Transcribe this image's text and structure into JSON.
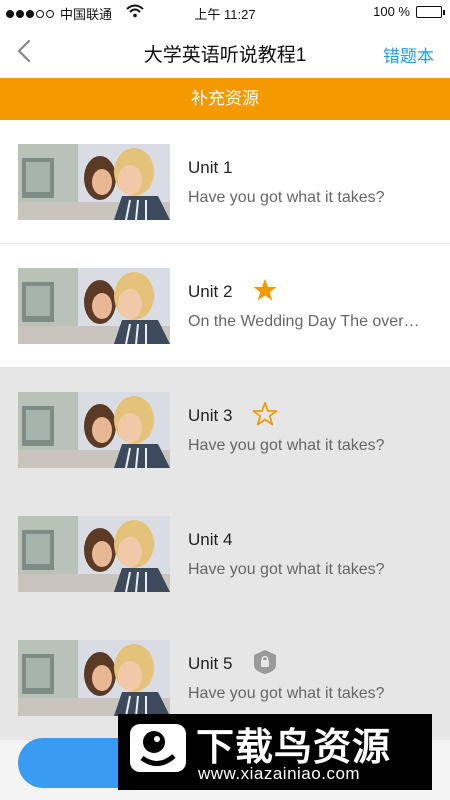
{
  "status_bar": {
    "carrier": "中国联通",
    "time": "上午 11:27",
    "battery": "100 %",
    "battery_level": 1.0
  },
  "nav": {
    "title": "大学英语听说教程1",
    "action_label": "错题本"
  },
  "section": {
    "label": "补充资源"
  },
  "units": [
    {
      "title": "Unit 1",
      "subtitle": "Have you got what it takes?",
      "badge": "none",
      "state": "normal"
    },
    {
      "title": "Unit 2",
      "subtitle": "On the Wedding Day The over…",
      "badge": "star-filled-icon",
      "state": "normal"
    },
    {
      "title": "Unit 3",
      "subtitle": "Have you got what it takes?",
      "badge": "star-outline-icon",
      "state": "highlighted"
    },
    {
      "title": "Unit 4",
      "subtitle": "Have you got what it takes?",
      "badge": "none",
      "state": "highlighted"
    },
    {
      "title": "Unit 5",
      "subtitle": "Have you got what it takes?",
      "badge": "lock-icon",
      "state": "highlighted"
    }
  ],
  "watermark": {
    "brand": "下载鸟资源",
    "url": "www.xiazainiao.com"
  },
  "colors": {
    "accent_orange": "#f49a00",
    "link_blue": "#1d9ee8",
    "button_blue": "#3a9bf2",
    "highlight_gray": "#e6e6e6"
  }
}
